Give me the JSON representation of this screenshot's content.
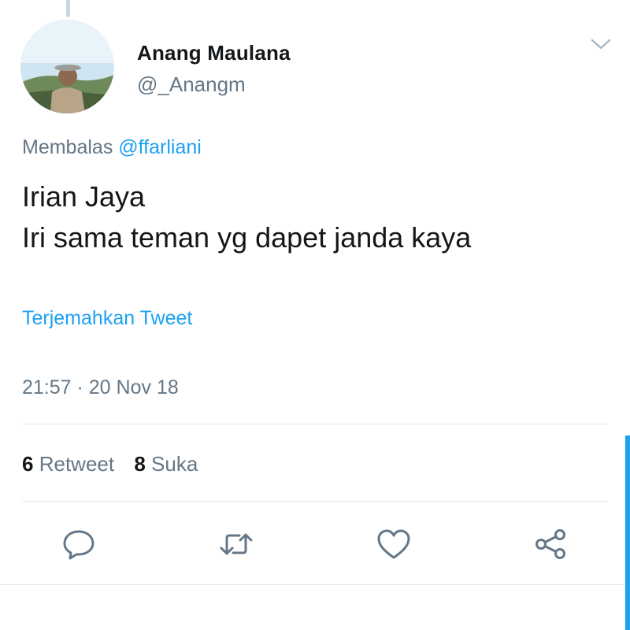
{
  "tweet": {
    "display_name": "Anang Maulana",
    "handle": "@_Anangm",
    "reply_prefix": "Membalas",
    "reply_to": "@ffarliani",
    "text_lines": [
      "Irian Jaya",
      "Iri sama teman yg dapet janda kaya"
    ],
    "translate_label": "Terjemahkan Tweet",
    "timestamp": "21:57 · 20 Nov 18",
    "retweet_count": "6",
    "retweet_label": "Retweet",
    "like_count": "8",
    "like_label": "Suka"
  },
  "icons": {
    "menu": "chevron-down-icon",
    "reply": "reply-icon",
    "retweet": "retweet-icon",
    "like": "heart-icon",
    "share": "share-icon"
  },
  "colors": {
    "text": "#14171a",
    "secondary": "#657786",
    "accent": "#1da1f2",
    "divider": "#e1e8ed"
  }
}
